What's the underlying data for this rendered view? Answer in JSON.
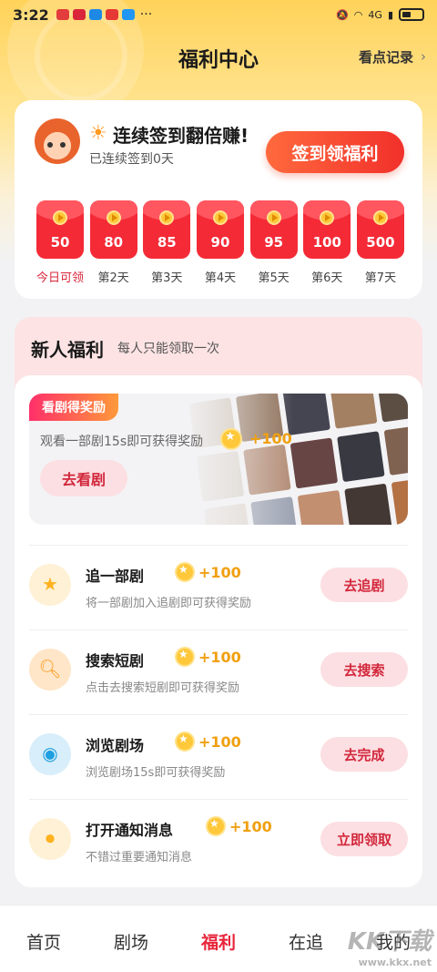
{
  "status_bar": {
    "time": "3:22",
    "network": "4G",
    "more": "···"
  },
  "header": {
    "title": "福利中心",
    "record_link": "看点记录",
    "chevron": "›"
  },
  "checkin": {
    "title": "连续签到翻倍赚!",
    "subtitle": "已连续签到0天",
    "button": "签到领福利",
    "days": [
      {
        "value": "50",
        "label": "今日可领"
      },
      {
        "value": "80",
        "label": "第2天"
      },
      {
        "value": "85",
        "label": "第3天"
      },
      {
        "value": "90",
        "label": "第4天"
      },
      {
        "value": "95",
        "label": "第5天"
      },
      {
        "value": "100",
        "label": "第6天"
      },
      {
        "value": "500",
        "label": "第7天"
      }
    ]
  },
  "newbie": {
    "title": "新人福利",
    "subtitle": "每人只能领取一次",
    "banner": {
      "tag": "看剧得奖励",
      "desc": "观看一部剧15s即可获得奖励",
      "reward": "+100",
      "button": "去看剧"
    },
    "tasks": [
      {
        "name": "追一部剧",
        "reward": "+100",
        "desc": "将一部剧加入追剧即可获得奖励",
        "button": "去追剧",
        "icon": "star-icon"
      },
      {
        "name": "搜索短剧",
        "reward": "+100",
        "desc": "点击去搜索短剧即可获得奖励",
        "button": "去搜索",
        "icon": "search-icon"
      },
      {
        "name": "浏览剧场",
        "reward": "+100",
        "desc": "浏览剧场15s即可获得奖励",
        "button": "去完成",
        "icon": "eye-icon"
      },
      {
        "name": "打开通知消息",
        "reward": "+100",
        "desc": "不错过重要通知消息",
        "button": "立即领取",
        "icon": "toggle-icon"
      }
    ]
  },
  "tabbar": {
    "tabs": [
      "首页",
      "剧场",
      "福利",
      "在追",
      "我的"
    ],
    "active": "福利"
  },
  "watermark": {
    "brand": "KK下载",
    "url": "www.kkx.net"
  },
  "colors": {
    "accent": "#e8243a",
    "gold": "#f0a011",
    "header_yellow": "#ffd35a"
  }
}
